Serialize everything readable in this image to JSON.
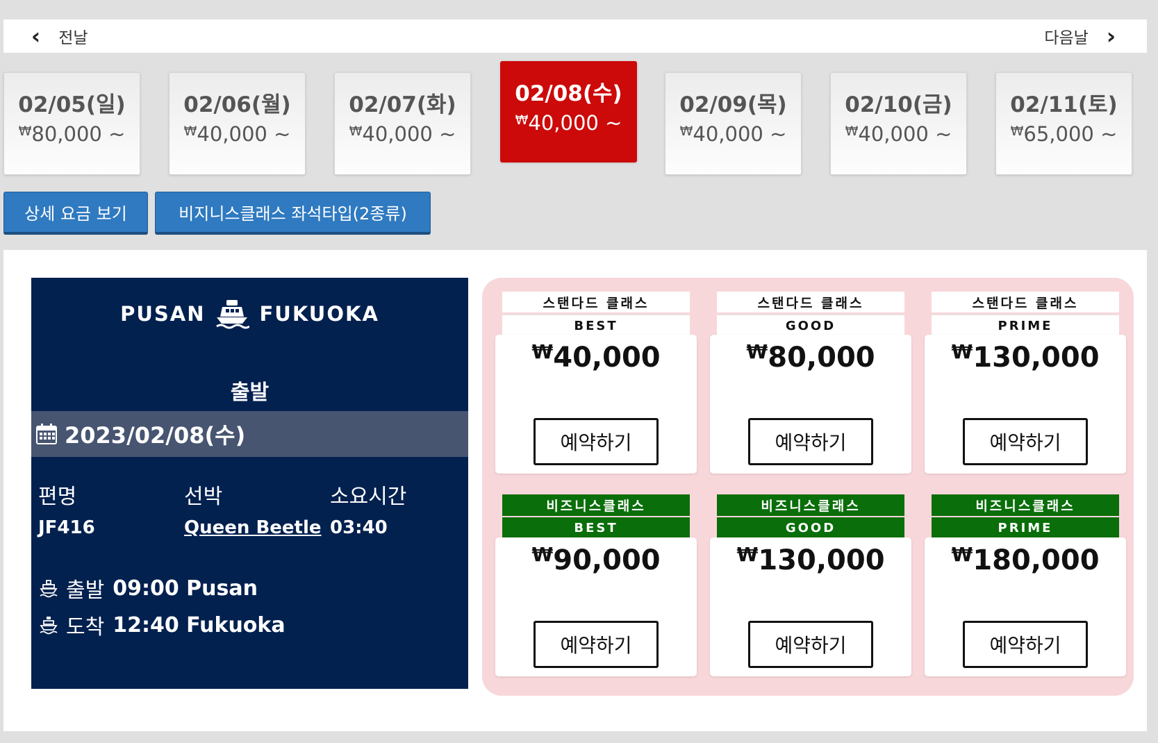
{
  "nav": {
    "prev_label": "전날",
    "next_label": "다음날"
  },
  "days": [
    {
      "date": "02/05(일)",
      "currency": "₩",
      "price": "80,000 ~"
    },
    {
      "date": "02/06(월)",
      "currency": "₩",
      "price": "40,000 ~"
    },
    {
      "date": "02/07(화)",
      "currency": "₩",
      "price": "40,000 ~"
    },
    {
      "date": "02/08(수)",
      "currency": "₩",
      "price": "40,000 ~"
    },
    {
      "date": "02/09(목)",
      "currency": "₩",
      "price": "40,000 ~"
    },
    {
      "date": "02/10(금)",
      "currency": "₩",
      "price": "40,000 ~"
    },
    {
      "date": "02/11(토)",
      "currency": "₩",
      "price": "65,000 ~"
    }
  ],
  "buttons": {
    "detail_fare": "상세 요금 보기",
    "business_seat": "비지니스클래스 좌석타입(2종류)"
  },
  "voyage": {
    "origin": "PUSAN",
    "destination": "FUKUOKA",
    "section_title": "출발",
    "date": "2023/02/08(수)",
    "labels": {
      "flight": "편명",
      "ship": "선박",
      "duration": "소요시간"
    },
    "flight_no": "JF416",
    "ship_name": "Queen Beetle",
    "duration": "03:40",
    "departure": {
      "label": "출발",
      "value": "09:00 Pusan"
    },
    "arrival": {
      "label": "도착",
      "value": "12:40 Fukuoka"
    }
  },
  "fares": [
    {
      "class": "스탠다드 클래스",
      "grade": "BEST",
      "currency": "₩",
      "price": "40,000",
      "button": "예약하기"
    },
    {
      "class": "스탠다드 클래스",
      "grade": "GOOD",
      "currency": "₩",
      "price": "80,000",
      "button": "예약하기"
    },
    {
      "class": "스탠다드 클래스",
      "grade": "PRIME",
      "currency": "₩",
      "price": "130,000",
      "button": "예약하기"
    },
    {
      "class": "비즈니스클래스",
      "grade": "BEST",
      "currency": "₩",
      "price": "90,000",
      "button": "예약하기"
    },
    {
      "class": "비즈니스클래스",
      "grade": "GOOD",
      "currency": "₩",
      "price": "130,000",
      "button": "예약하기"
    },
    {
      "class": "비즈니스클래스",
      "grade": "PRIME",
      "currency": "₩",
      "price": "180,000",
      "button": "예약하기"
    }
  ],
  "colors": {
    "selected_day": "#cc0a0a",
    "panel_navy": "#03214f",
    "business_green": "#0a6e0a",
    "fare_bg": "#f8d7db",
    "button_blue": "#2f7ac0"
  }
}
